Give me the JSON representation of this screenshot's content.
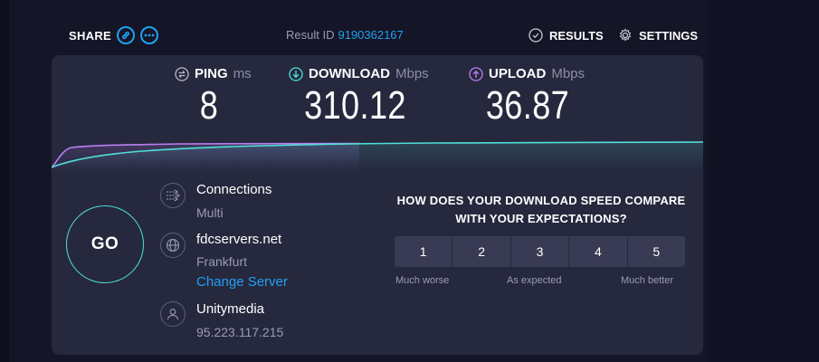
{
  "header": {
    "share_label": "SHARE",
    "result_label": "Result ID",
    "result_id": "9190362167",
    "results_label": "RESULTS",
    "settings_label": "SETTINGS"
  },
  "metrics": {
    "ping": {
      "label": "PING",
      "unit": "ms",
      "value": "8"
    },
    "download": {
      "label": "DOWNLOAD",
      "unit": "Mbps",
      "value": "310.12"
    },
    "upload": {
      "label": "UPLOAD",
      "unit": "Mbps",
      "value": "36.87"
    }
  },
  "go_label": "GO",
  "connections": {
    "title": "Connections",
    "value": "Multi"
  },
  "server": {
    "host": "fdcservers.net",
    "location": "Frankfurt",
    "change_label": "Change Server"
  },
  "provider": {
    "name": "Unitymedia",
    "ip": "95.223.117.215"
  },
  "survey": {
    "question": "HOW DOES YOUR DOWNLOAD SPEED COMPARE WITH YOUR EXPECTATIONS?",
    "options": [
      "1",
      "2",
      "3",
      "4",
      "5"
    ],
    "low_label": "Much worse",
    "mid_label": "As expected",
    "high_label": "Much better"
  },
  "colors": {
    "accent": "#1fa2f0",
    "download": "#4fe0d8",
    "upload": "#b87ff0",
    "card": "#26283e",
    "background": "#141526"
  },
  "icons": {
    "share_link": "link-icon",
    "share_more": "more-icon",
    "results": "check-circle-icon",
    "settings": "gear-icon",
    "ping": "ping-icon",
    "download": "download-arrow-icon",
    "upload": "upload-arrow-icon",
    "connections": "connections-icon",
    "server": "globe-icon",
    "provider": "user-icon"
  }
}
